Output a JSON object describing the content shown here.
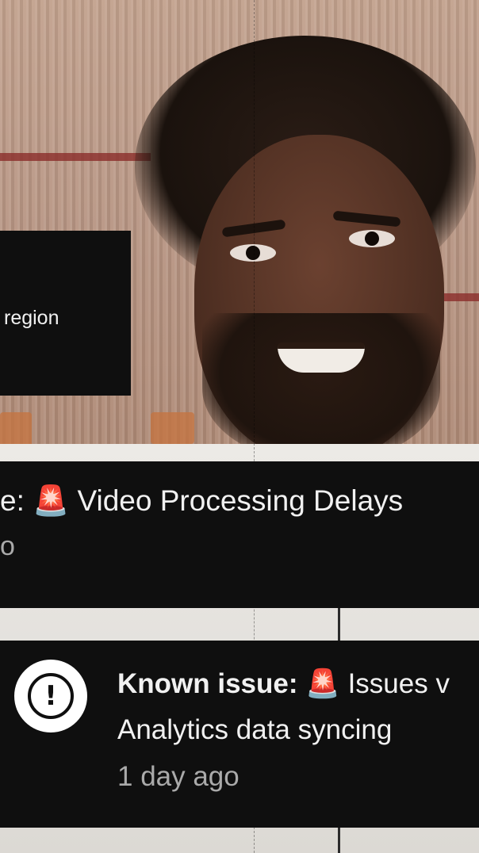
{
  "region_card": {
    "text": "region"
  },
  "notice_top": {
    "title_prefix": "e: ",
    "siren": "🚨",
    "title_rest": " Video Processing Delays",
    "subtitle": "o"
  },
  "notice_bottom": {
    "title_label": "Known issue:",
    "siren": "🚨",
    "title_rest": " Issues v",
    "body": "Analytics data syncing",
    "time": "1 day ago",
    "icon": "exclamation-alert-icon"
  }
}
